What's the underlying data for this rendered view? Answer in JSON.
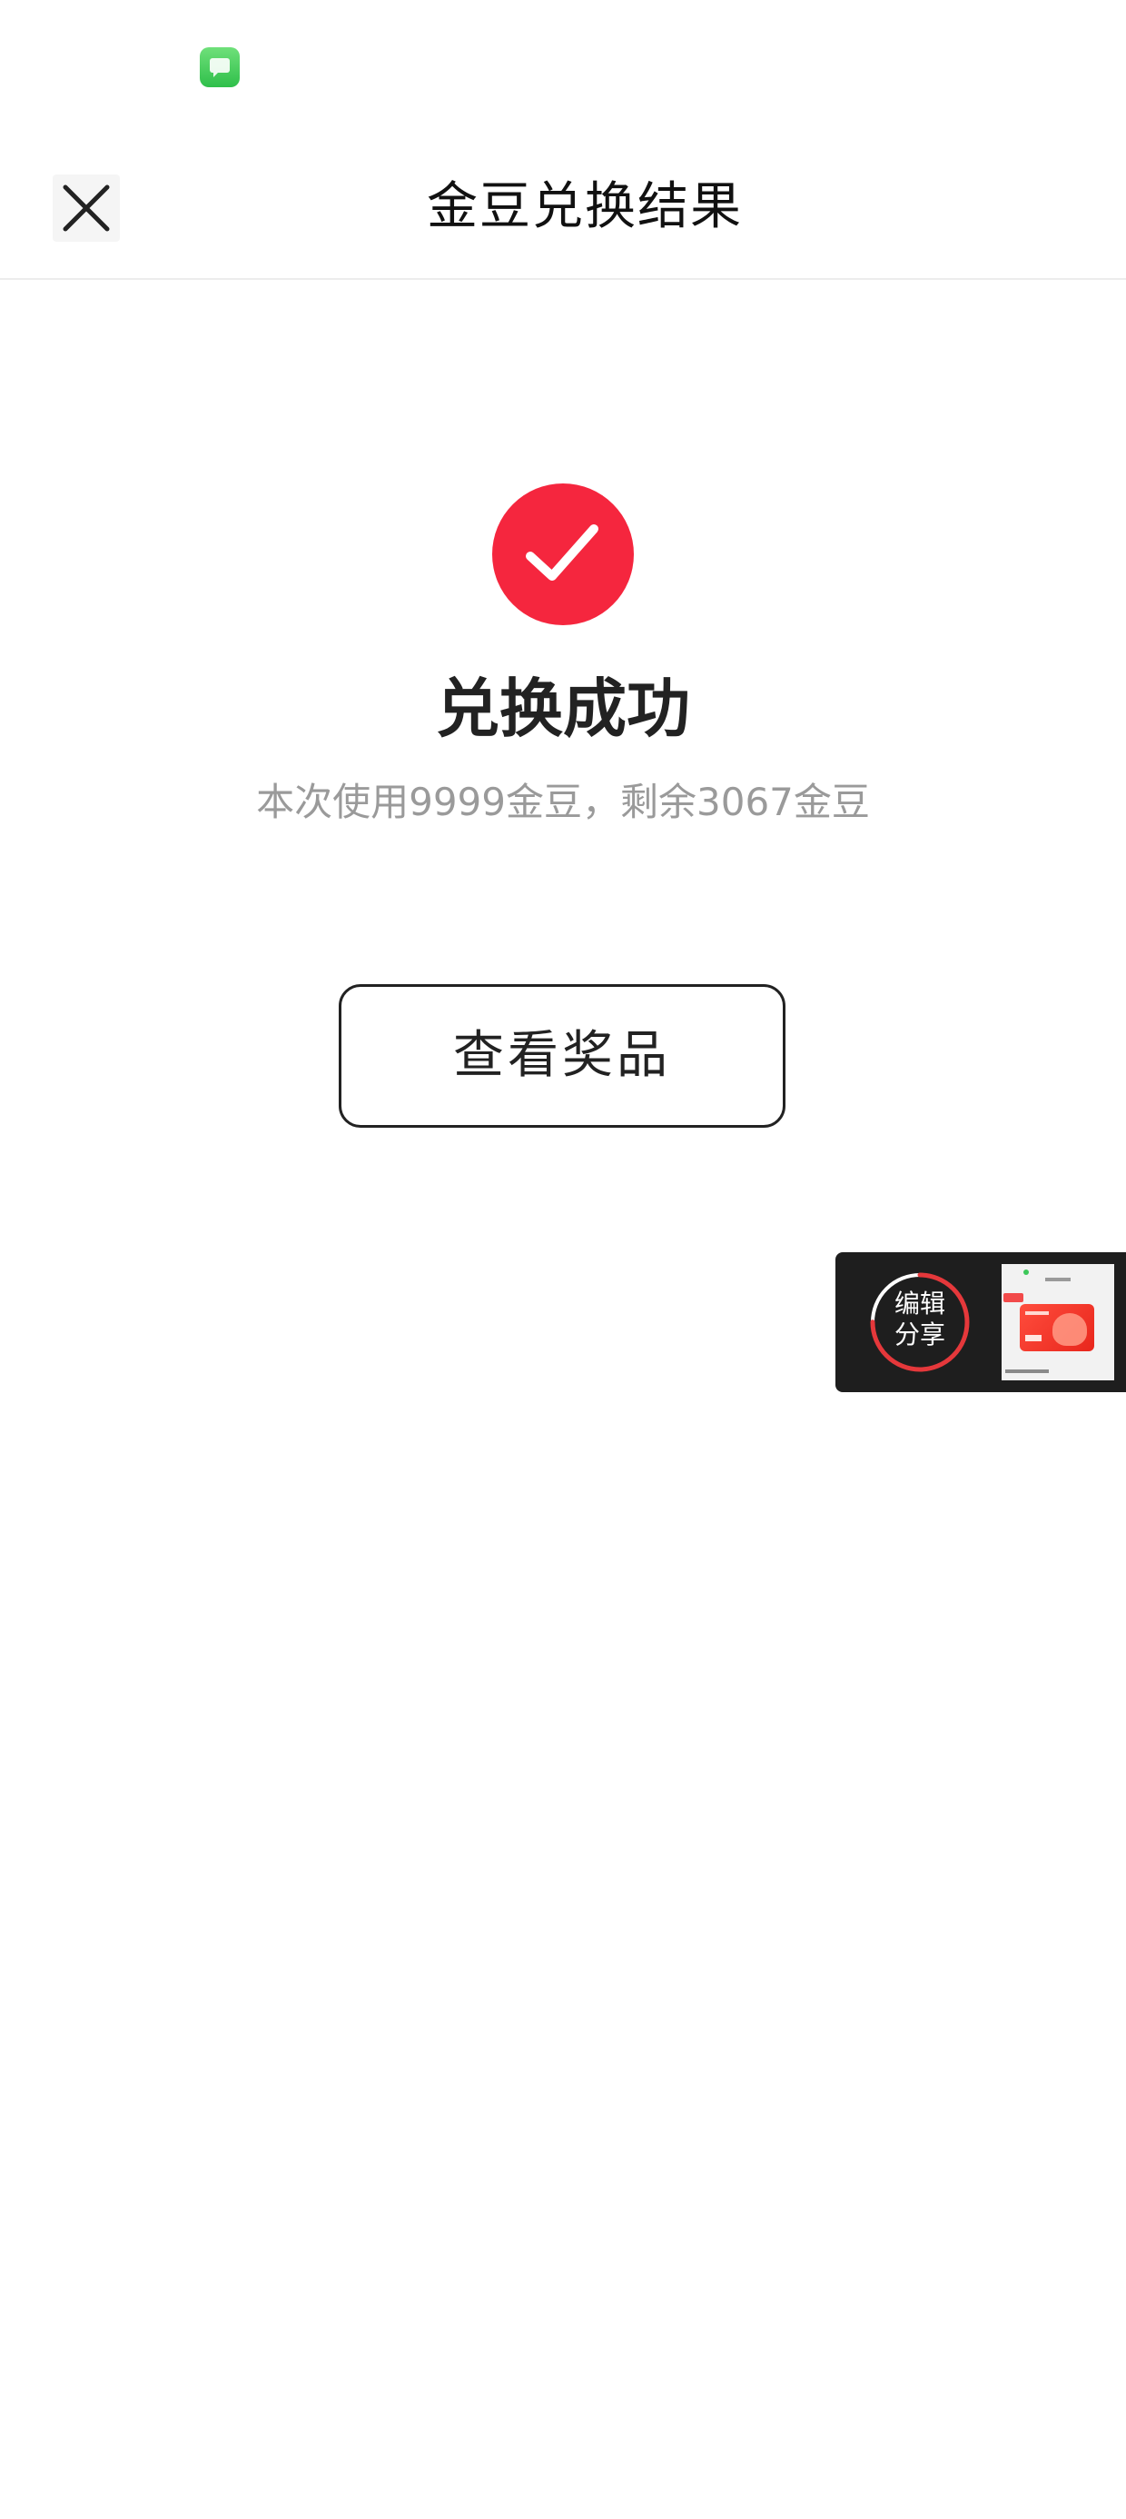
{
  "status_bar": {
    "notification_icon": "message-app-icon"
  },
  "nav": {
    "title": "金豆兑换结果",
    "close_icon": "close-icon"
  },
  "result": {
    "icon": "check-circle-icon",
    "accent_color": "#f5263e",
    "title": "兑换成功",
    "subtitle": "本次使用9999金豆，剩余3067金豆"
  },
  "actions": {
    "view_prize_label": "查看奖品"
  },
  "share_float": {
    "label_line1": "编辑",
    "label_line2": "分享",
    "thumbnail": "screenshot-thumbnail"
  }
}
